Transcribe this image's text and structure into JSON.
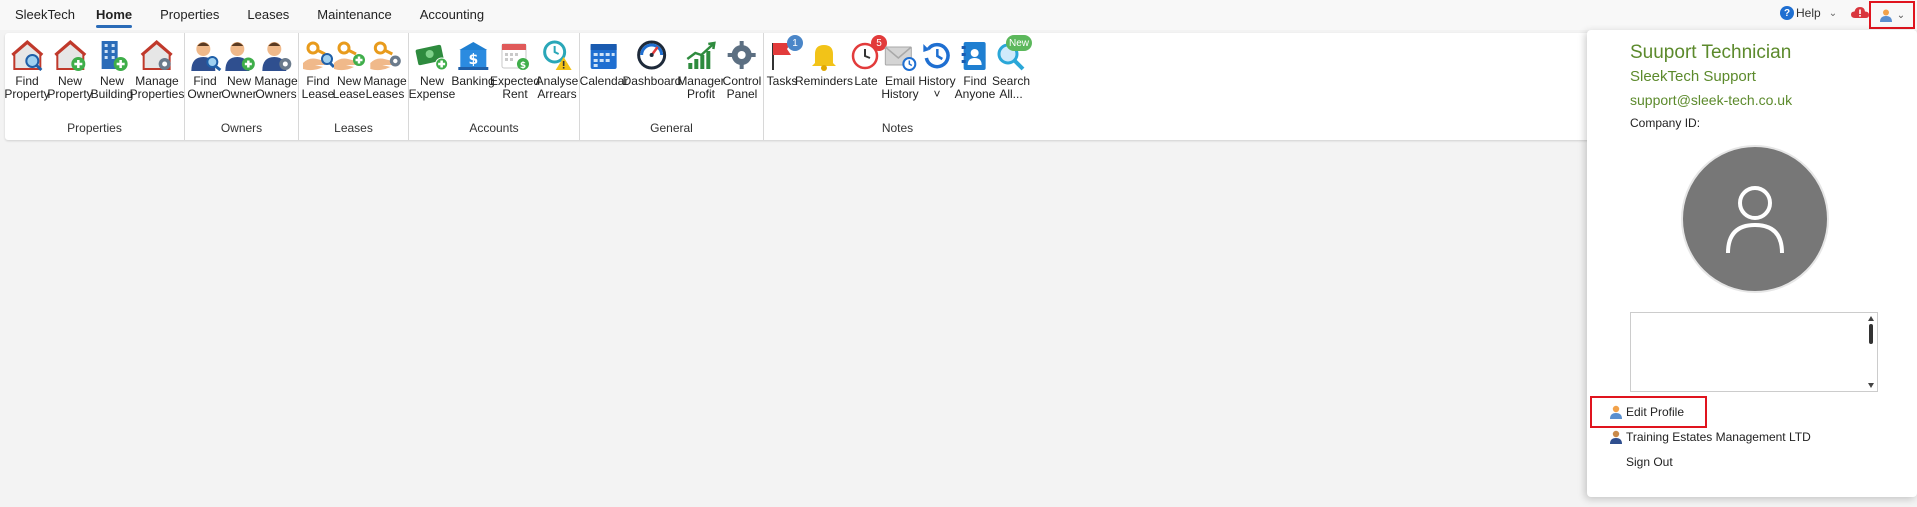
{
  "app": {
    "title": "SleekTech"
  },
  "tabs": [
    {
      "label": "Home",
      "active": true
    },
    {
      "label": "Properties",
      "active": false
    },
    {
      "label": "Leases",
      "active": false
    },
    {
      "label": "Maintenance",
      "active": false
    },
    {
      "label": "Accounting",
      "active": false
    }
  ],
  "topright": {
    "help_label": "Help",
    "help_icon": "question-circle-icon"
  },
  "ribbon": {
    "groups": [
      {
        "label": "Properties",
        "buttons": [
          {
            "label": "Find\nProperty",
            "icon": "house-magnifier-icon"
          },
          {
            "label": "New\nProperty",
            "icon": "house-plus-icon"
          },
          {
            "label": "New\nBuilding",
            "icon": "building-plus-icon"
          },
          {
            "label": "Manage\nProperties",
            "icon": "house-gear-icon"
          }
        ]
      },
      {
        "label": "Owners",
        "buttons": [
          {
            "label": "Find\nOwner",
            "icon": "person-magnifier-icon"
          },
          {
            "label": "New\nOwner",
            "icon": "person-plus-icon"
          },
          {
            "label": "Manage\nOwners",
            "icon": "person-gear-icon"
          }
        ]
      },
      {
        "label": "Leases",
        "buttons": [
          {
            "label": "Find\nLease",
            "icon": "hand-key-magnifier-icon"
          },
          {
            "label": "New\nLease",
            "icon": "hand-key-plus-icon"
          },
          {
            "label": "Manage\nLeases",
            "icon": "hand-key-gear-icon"
          }
        ]
      },
      {
        "label": "Accounts",
        "buttons": [
          {
            "label": "New\nExpense",
            "icon": "money-plus-icon"
          },
          {
            "label": "Banking",
            "icon": "bank-icon"
          },
          {
            "label": "Expected\nRent",
            "icon": "calendar-money-icon"
          },
          {
            "label": "Analyse\nArrears",
            "icon": "clock-warning-icon"
          }
        ]
      },
      {
        "label": "General",
        "buttons": [
          {
            "label": "Calendar",
            "icon": "calendar-icon"
          },
          {
            "label": "Dashboard",
            "icon": "gauge-icon"
          },
          {
            "label": "Manager\nProfit",
            "icon": "growth-chart-icon"
          },
          {
            "label": "Control\nPanel",
            "icon": "gear-icon"
          }
        ]
      },
      {
        "label": "Notes",
        "buttons": [
          {
            "label": "Tasks",
            "icon": "flag-icon",
            "badge": "1"
          },
          {
            "label": "Reminders",
            "icon": "bell-icon"
          },
          {
            "label": "Late",
            "icon": "alarm-clock-icon",
            "badge": "5"
          },
          {
            "label": "Email\nHistory",
            "icon": "envelope-clock-icon"
          },
          {
            "label": "History\n˅",
            "icon": "history-icon"
          },
          {
            "label": "Find\nAnyone",
            "icon": "contact-book-icon"
          },
          {
            "label": "Search\nAll...",
            "icon": "search-new-icon",
            "badge": "New"
          }
        ]
      }
    ]
  },
  "profile": {
    "name": "Suuport Technician",
    "company": "SleekTech Support",
    "email": "support@sleek-tech.co.uk",
    "company_id_label": "Company ID:",
    "menu": [
      {
        "label": "Edit Profile",
        "icon": "user-icon"
      },
      {
        "label": "Training Estates Management LTD",
        "icon": "company-user-icon"
      },
      {
        "label": "Sign Out",
        "icon": ""
      }
    ]
  },
  "colors": {
    "accent": "#2b6cb8",
    "profile_text": "#5c8a2c",
    "highlight": "#e0141e",
    "badge_blue": "#4a86c8",
    "badge_red": "#e23b3b",
    "badge_green": "#5cb85c"
  }
}
